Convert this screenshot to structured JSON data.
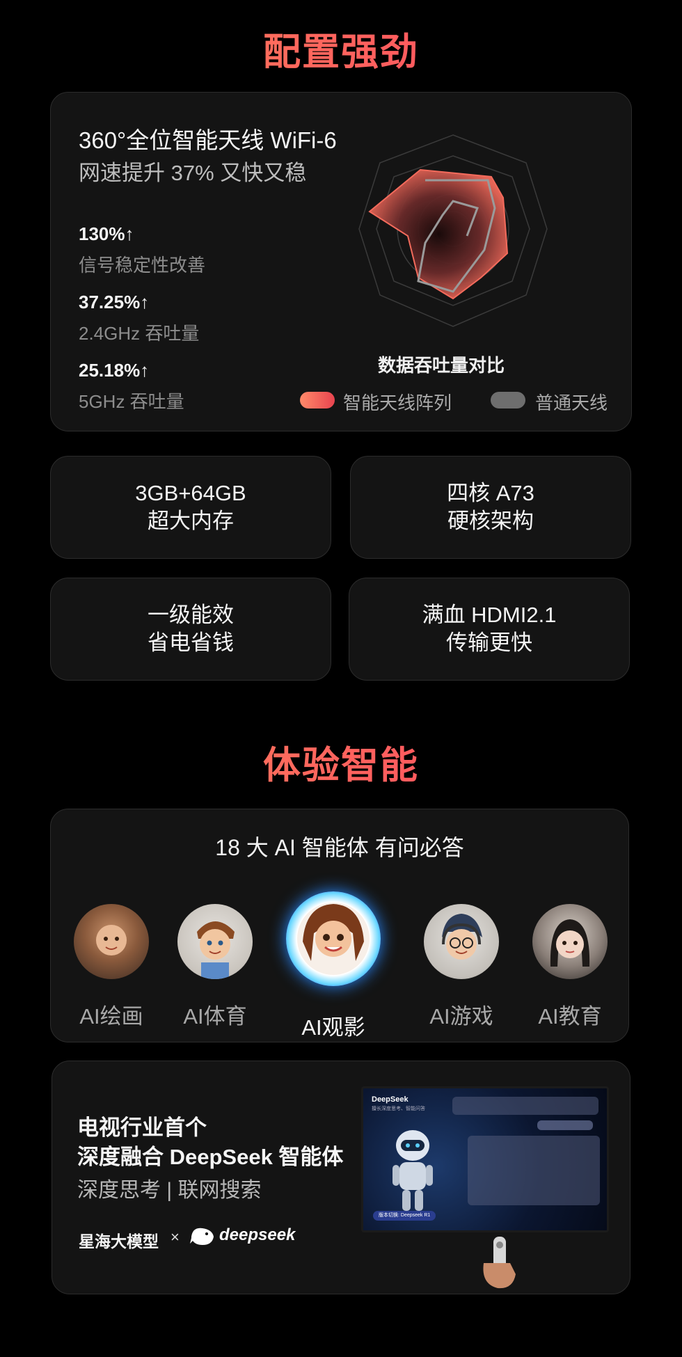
{
  "section1": {
    "title": "配置强劲",
    "wifi_card": {
      "title": "360°全位智能天线 WiFi-6",
      "subtitle": "网速提升 37% 又快又稳",
      "stats": [
        {
          "value": "130%↑",
          "label": "信号稳定性改善"
        },
        {
          "value": "37.25%↑",
          "label": "2.4GHz 吞吐量"
        },
        {
          "value": "25.18%↑",
          "label": "5GHz 吞吐量"
        }
      ],
      "radar_title": "数据吞吐量对比",
      "legend": [
        {
          "name": "智能天线阵列",
          "color": "#ef5a52"
        },
        {
          "name": "普通天线",
          "color": "#6e6e6e"
        }
      ]
    },
    "spec_cards": [
      {
        "line1": "3GB+64GB",
        "line2": "超大内存"
      },
      {
        "line1": "四核 A73",
        "line2": "硬核架构"
      },
      {
        "line1": "一级能效",
        "line2": "省电省钱"
      },
      {
        "line1": "满血 HDMI2.1",
        "line2": "传输更快"
      }
    ]
  },
  "section2": {
    "title": "体验智能",
    "ai_card": {
      "heading": "18 大 AI 智能体 有问必答",
      "agents": [
        {
          "label": "AI绘画",
          "selected": false
        },
        {
          "label": "AI体育",
          "selected": false
        },
        {
          "label": "AI观影",
          "selected": true
        },
        {
          "label": "AI游戏",
          "selected": false
        },
        {
          "label": "AI教育",
          "selected": false
        }
      ]
    },
    "deepseek_card": {
      "line1": "电视行业首个",
      "line2": "深度融合 DeepSeek 智能体",
      "subline": "深度思考 | 联网搜索",
      "brand": "星海大模型",
      "brand_x": "×",
      "partner": "deepseek",
      "tv_screen": {
        "app_name": "DeepSeek",
        "app_sub": "擅长深度思考、智能问答",
        "pill": "版本切换: Deepseek R1"
      }
    }
  }
}
